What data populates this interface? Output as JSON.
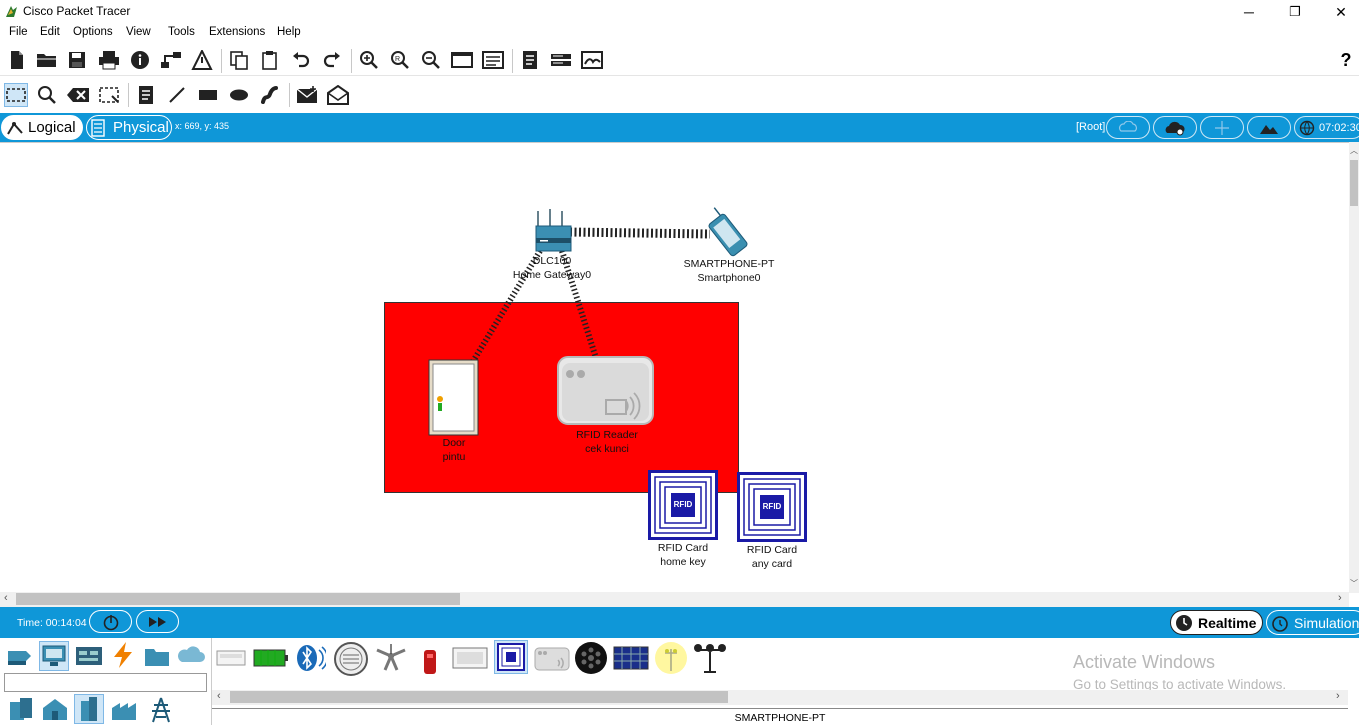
{
  "window": {
    "title": "Cisco Packet Tracer",
    "min_glyph": "─",
    "restore_glyph": "❐",
    "close_glyph": "✕"
  },
  "menu": [
    "File",
    "Edit",
    "Options",
    "View",
    "Tools",
    "Extensions",
    "Help"
  ],
  "toolbar": {
    "help_glyph": "?"
  },
  "view_bar": {
    "logical_label": "Logical",
    "physical_label": "Physical",
    "coords": "x: 669, y: 435",
    "root_label": "[Root]",
    "clock": "07:02:30"
  },
  "devices": {
    "gateway": {
      "model": "DLC100",
      "name": "Home Gateway0"
    },
    "smartphone": {
      "model": "SMARTPHONE-PT",
      "name": "Smartphone0"
    },
    "door": {
      "model": "Door",
      "name": "pintu"
    },
    "rfid_reader": {
      "model": "RFID Reader",
      "name": "cek kunci"
    },
    "rfid_card1": {
      "model": "RFID Card",
      "name": "home key",
      "tag": "RFID"
    },
    "rfid_card2": {
      "model": "RFID Card",
      "name": "any card",
      "tag": "RFID"
    }
  },
  "time_bar": {
    "time": "Time: 00:14:04",
    "realtime_label": "Realtime",
    "simulation_label": "Simulation"
  },
  "bottom": {
    "selected_device": "SMARTPHONE-PT",
    "watermark_title": "Activate Windows",
    "watermark_sub": "Go to Settings to activate Windows."
  },
  "colors": {
    "accent": "#0f97d8",
    "zone": "#ff0000",
    "rfid_blue": "#1a1aa6"
  }
}
